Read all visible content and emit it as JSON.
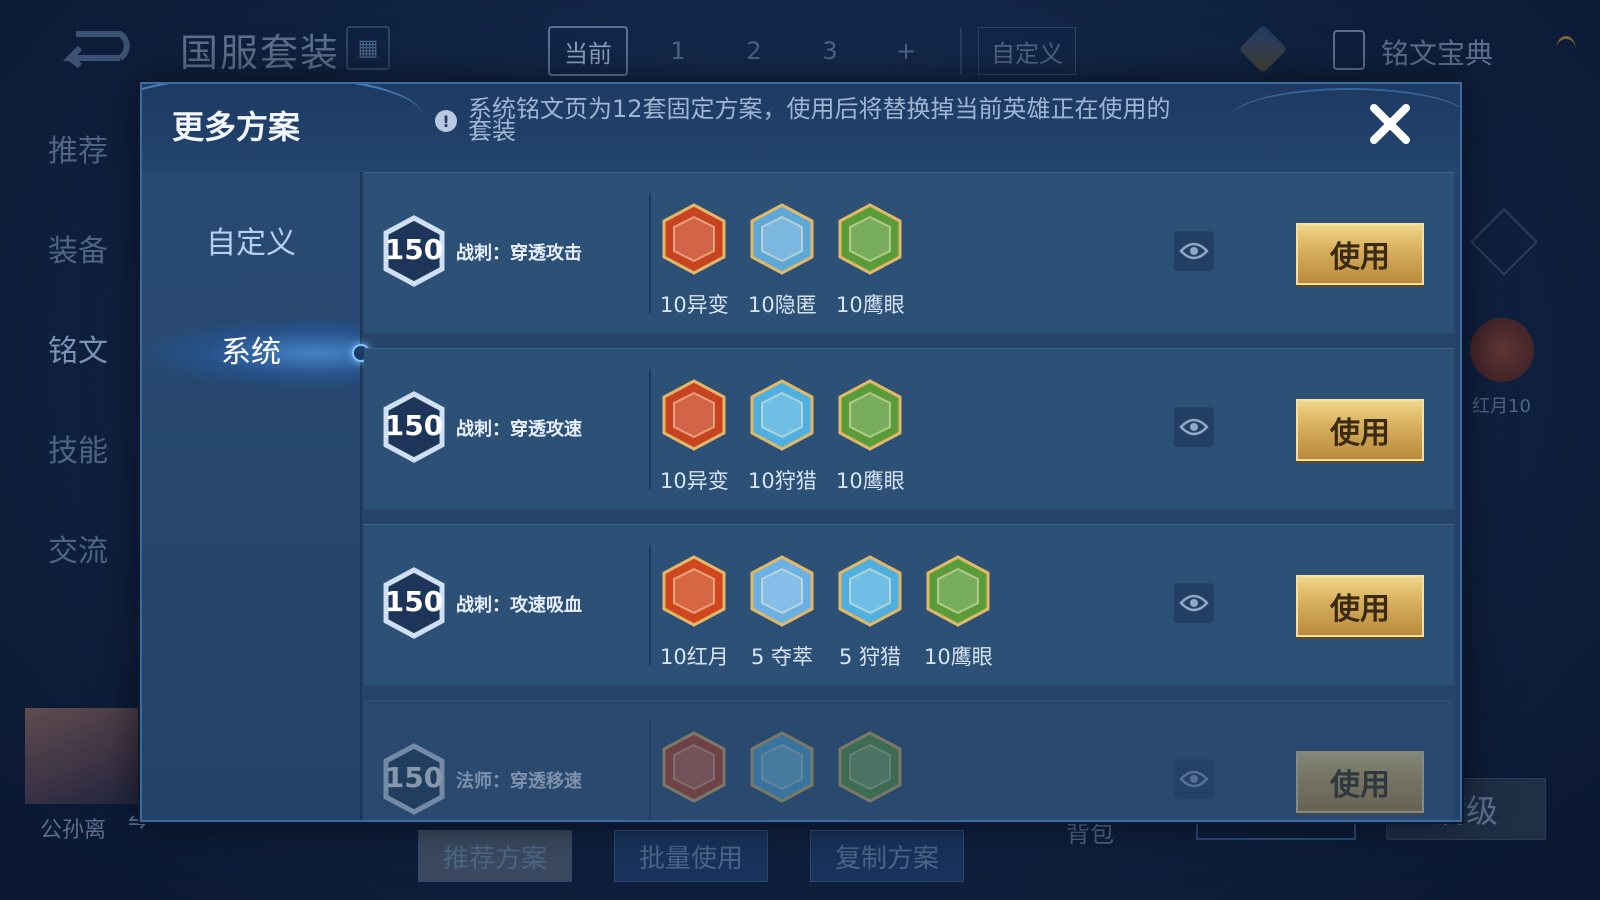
{
  "background": {
    "page_title": "国服套装",
    "tabs": [
      "当前",
      "1",
      "2",
      "3",
      "+"
    ],
    "custom_tab": "自定义",
    "rune_book_label": "铭文宝典",
    "side_nav": [
      "推荐",
      "装备",
      "铭文",
      "技能",
      "交流"
    ],
    "hero_name": "公孙离",
    "bottom_buttons": [
      "推荐方案",
      "批量使用",
      "复制方案"
    ],
    "bag_label": "背包",
    "max_level_label": "满级",
    "right_rune_label": "红月10"
  },
  "modal": {
    "title": "更多方案",
    "notice": "系统铭文页为12套固定方案，使用后将替换掉当前英雄正在使用的套装",
    "nav": {
      "custom": "自定义",
      "system": "系统"
    },
    "use_label": "使用",
    "schemes": [
      {
        "level": "150",
        "name": "战刺：穿透攻击",
        "runes": [
          {
            "label": "10异变",
            "color": "#c8431f"
          },
          {
            "label": "10隐匿",
            "color": "#5ea8d8"
          },
          {
            "label": "10鹰眼",
            "color": "#5a9c3a"
          }
        ]
      },
      {
        "level": "150",
        "name": "战刺：穿透攻速",
        "runes": [
          {
            "label": "10异变",
            "color": "#c8431f"
          },
          {
            "label": "10狩猎",
            "color": "#4fb0e0"
          },
          {
            "label": "10鹰眼",
            "color": "#5a9c3a"
          }
        ]
      },
      {
        "level": "150",
        "name": "战刺：攻速吸血",
        "runes": [
          {
            "label": "10红月",
            "color": "#d0461e"
          },
          {
            "label": "5 夺萃",
            "color": "#6ab0e4"
          },
          {
            "label": "5 狩猎",
            "color": "#4fb0e0"
          },
          {
            "label": "10鹰眼",
            "color": "#5a9c3a"
          }
        ]
      },
      {
        "level": "150",
        "name": "法师：穿透移速",
        "runes": [
          {
            "label": "",
            "color": "#c8431f"
          },
          {
            "label": "",
            "color": "#4fb0e0"
          },
          {
            "label": "",
            "color": "#5a9c3a"
          }
        ]
      }
    ]
  }
}
